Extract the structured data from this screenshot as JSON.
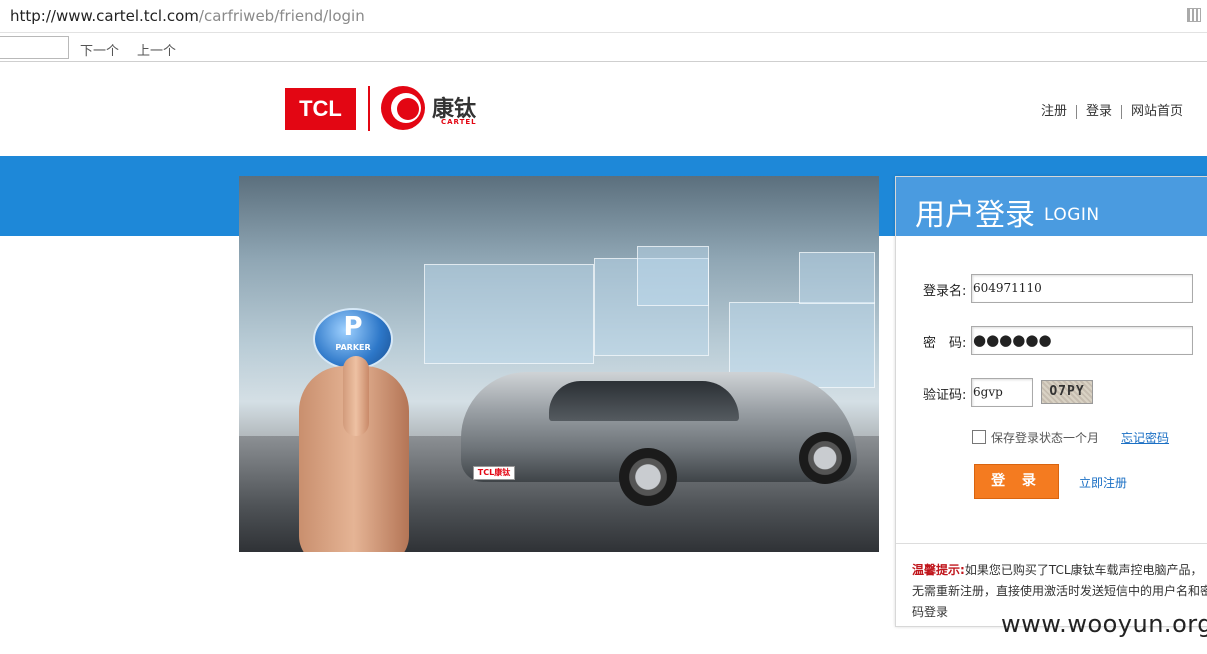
{
  "browser": {
    "url_host": "http://www.cartel.tcl.com",
    "url_path": "/carfriweb/friend/login",
    "find_next": "下一个",
    "find_prev": "上一个"
  },
  "header": {
    "logo_tcl": "TCL",
    "logo_cn": "康钛",
    "logo_en": "CARTEL",
    "links": [
      "注册",
      "登录",
      "网站首页"
    ]
  },
  "banner": {
    "button_text": "PARKER",
    "plate_text": "TCL康钛"
  },
  "login": {
    "title_cn": "用户登录",
    "title_en": "LOGIN",
    "username_label": "登录名:",
    "username_value": "604971110",
    "password_label": "密　码:",
    "password_value": "●●●●●●",
    "captcha_label": "验证码:",
    "captcha_value": "6gvp",
    "captcha_image_text": "O7PY",
    "remember_label": "保存登录状态一个月",
    "forgot_link": "忘记密码",
    "login_button": "登 录",
    "register_link": "立即注册",
    "tip_heading": "温馨提示:",
    "tip_body": "如果您已购买了TCL康钛车载声控电脑产品，无需重新注册，直接使用激活时发送短信中的用户名和密码登录"
  },
  "watermark": "www.wooyun.org",
  "colors": {
    "brand_red": "#e30613",
    "band_blue": "#1e88d8",
    "card_header_blue": "#4a9be0",
    "login_orange": "#f47b20",
    "link_blue": "#1a6fc4"
  }
}
